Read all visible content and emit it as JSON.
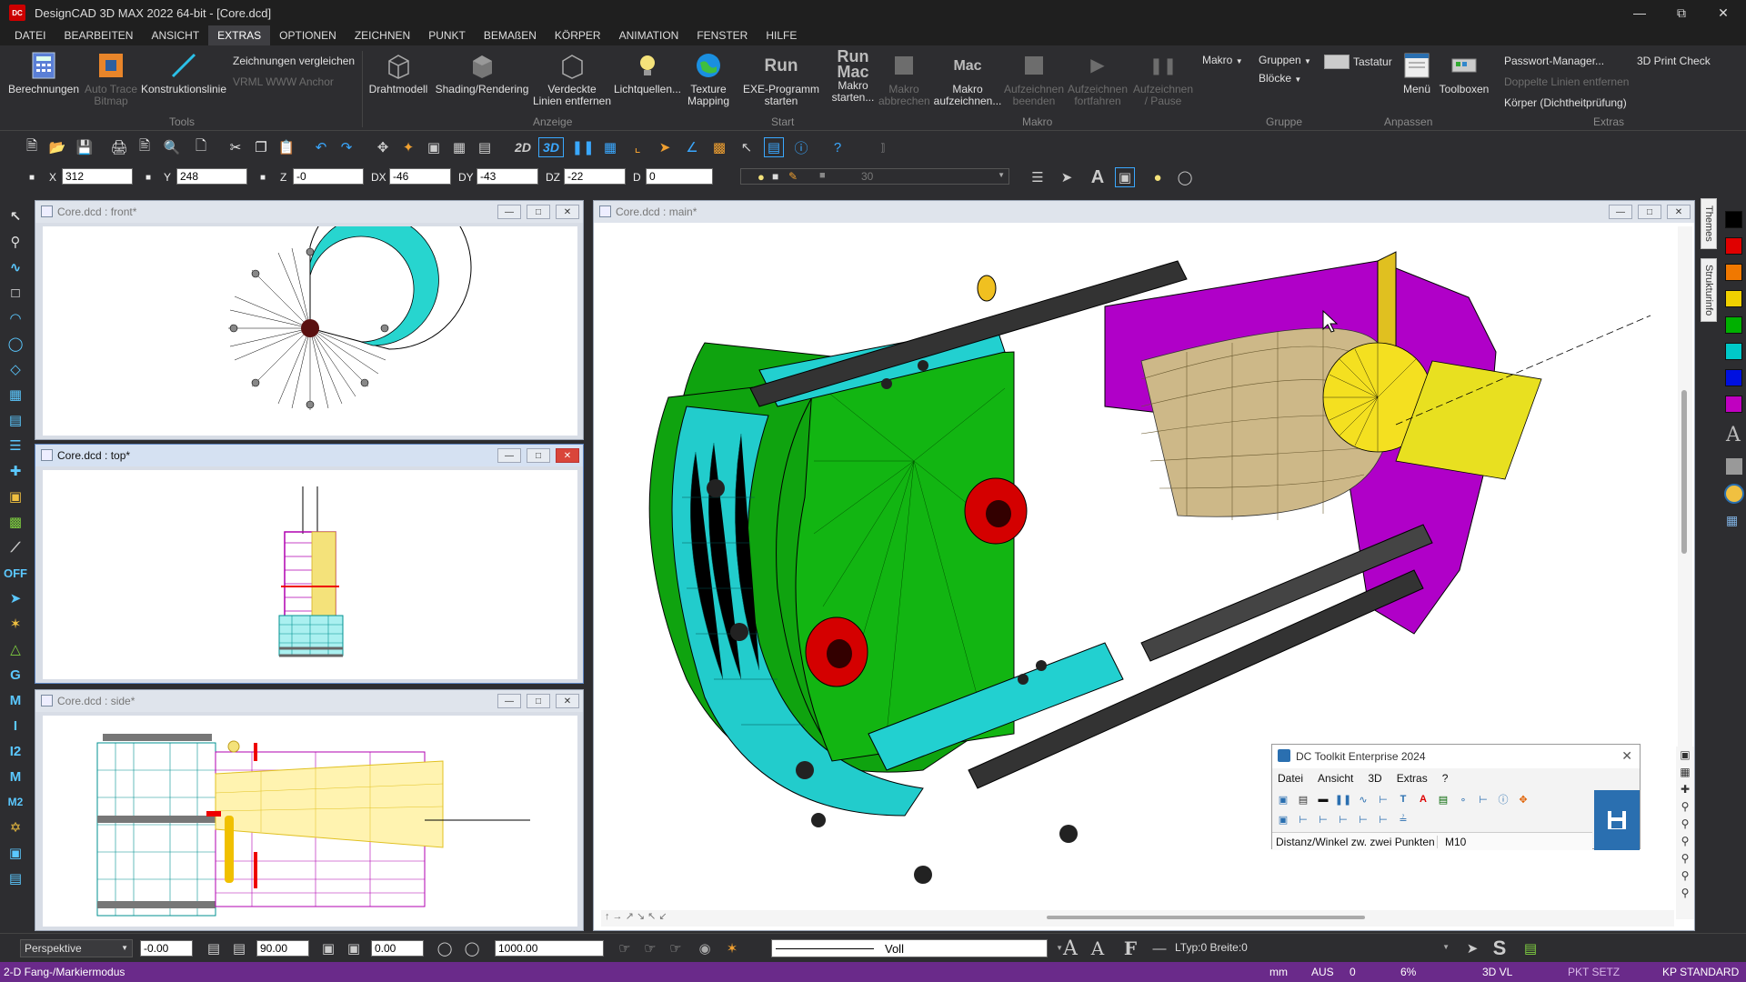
{
  "app": {
    "title": "DesignCAD 3D MAX 2022 64-bit - [Core.dcd]",
    "logo_text": "DC"
  },
  "menu": [
    "DATEI",
    "BEARBEITEN",
    "ANSICHT",
    "EXTRAS",
    "OPTIONEN",
    "ZEICHNEN",
    "PUNKT",
    "BEMAßEN",
    "KÖRPER",
    "ANIMATION",
    "FENSTER",
    "HILFE"
  ],
  "ribbon": {
    "tools": {
      "berechnungen": "Berechnungen",
      "auto_trace_1": "Auto Trace",
      "auto_trace_2": "Bitmap",
      "konstruktionslinie": "Konstruktionslinie",
      "vergleichen": "Zeichnungen vergleichen",
      "vrml": "VRML WWW Anchor",
      "group": "Tools"
    },
    "anzeige": {
      "draht": "Drahtmodell",
      "shading": "Shading/Rendering",
      "verdeckte_1": "Verdeckte",
      "verdeckte_2": "Linien entfernen",
      "licht": "Lichtquellen...",
      "texture_1": "Texture",
      "texture_2": "Mapping",
      "group": "Anzeige"
    },
    "start": {
      "exe_icon": "Run",
      "exe_1": "EXE-Programm",
      "exe_2": "starten",
      "group": "Start"
    },
    "makro": {
      "runmac_icon_1": "Run",
      "runmac_icon_2": "Mac",
      "m_start_1": "Makro",
      "m_start_2": "starten...",
      "m_abbr_1": "Makro",
      "m_abbr_2": "abbrechen",
      "mac_icon": "Mac",
      "m_auf_1": "Makro",
      "m_auf_2": "aufzeichnen...",
      "a_beenden_1": "Aufzeichnen",
      "a_beenden_2": "beenden",
      "a_fort_1": "Aufzeichnen",
      "a_fort_2": "fortfahren",
      "a_pause_1": "Aufzeichnen",
      "a_pause_2": "/ Pause",
      "makro_dd": "Makro",
      "group": "Makro"
    },
    "gruppe": {
      "gruppen": "Gruppen",
      "bloecke": "Blöcke",
      "group": "Gruppe"
    },
    "anpassen": {
      "tastatur": "Tastatur",
      "menue": "Menü",
      "toolboxen": "Toolboxen",
      "group": "Anpassen"
    },
    "extras": {
      "passwort": "Passwort-Manager...",
      "print3d": "3D Print Check",
      "doppelte": "Doppelte Linien entfernen",
      "koerper": "Körper (Dichtheitprüfung)",
      "group": "Extras"
    }
  },
  "toolbar": {
    "mode_2d": "2D",
    "mode_3d": "3D"
  },
  "coords": {
    "x_label": "X",
    "x": "312",
    "y_label": "Y",
    "y": "248",
    "z_label": "Z",
    "z": "-0",
    "dx_label": "DX",
    "dx": "-46",
    "dy_label": "DY",
    "dy": "-43",
    "dz_label": "DZ",
    "dz": "-22",
    "d_label": "D",
    "d": "0",
    "angle": "30"
  },
  "windows": {
    "front": "Core.dcd : front*",
    "top": "Core.dcd : top*",
    "side": "Core.dcd : side*",
    "main": "Core.dcd : main*"
  },
  "side_tabs": {
    "themes": "Themes",
    "struktur": "Strukturinfo"
  },
  "palette_colors": [
    "#000000",
    "#e00000",
    "#f07800",
    "#f0d000",
    "#00b000",
    "#00c8c8",
    "#0010e0",
    "#c000c0"
  ],
  "bottom": {
    "view": "Perspektive",
    "v1": "-0.00",
    "v2": "90.00",
    "v3": "0.00",
    "v4": "1000.00",
    "linestyle": "Voll",
    "ltyp": "LTyp:0  Breite:0"
  },
  "status": {
    "mode": "2-D Fang-/Markiermodus",
    "unit": "mm",
    "aus": "AUS",
    "zero": "0",
    "percent": "6%",
    "view": "3D VL",
    "pkt": "PKT SETZ",
    "kp": "KP STANDARD"
  },
  "toolkit": {
    "title": "DC Toolkit Enterprise 2024",
    "menu": [
      "Datei",
      "Ansicht",
      "3D",
      "Extras",
      "?"
    ],
    "status_text": "Distanz/Winkel zw. zwei Punkten",
    "status_code": "M10"
  },
  "left_tools": {
    "off": "OFF",
    "g": "G",
    "m": "M",
    "i": "I",
    "i2": "I2",
    "m2": "M2"
  }
}
